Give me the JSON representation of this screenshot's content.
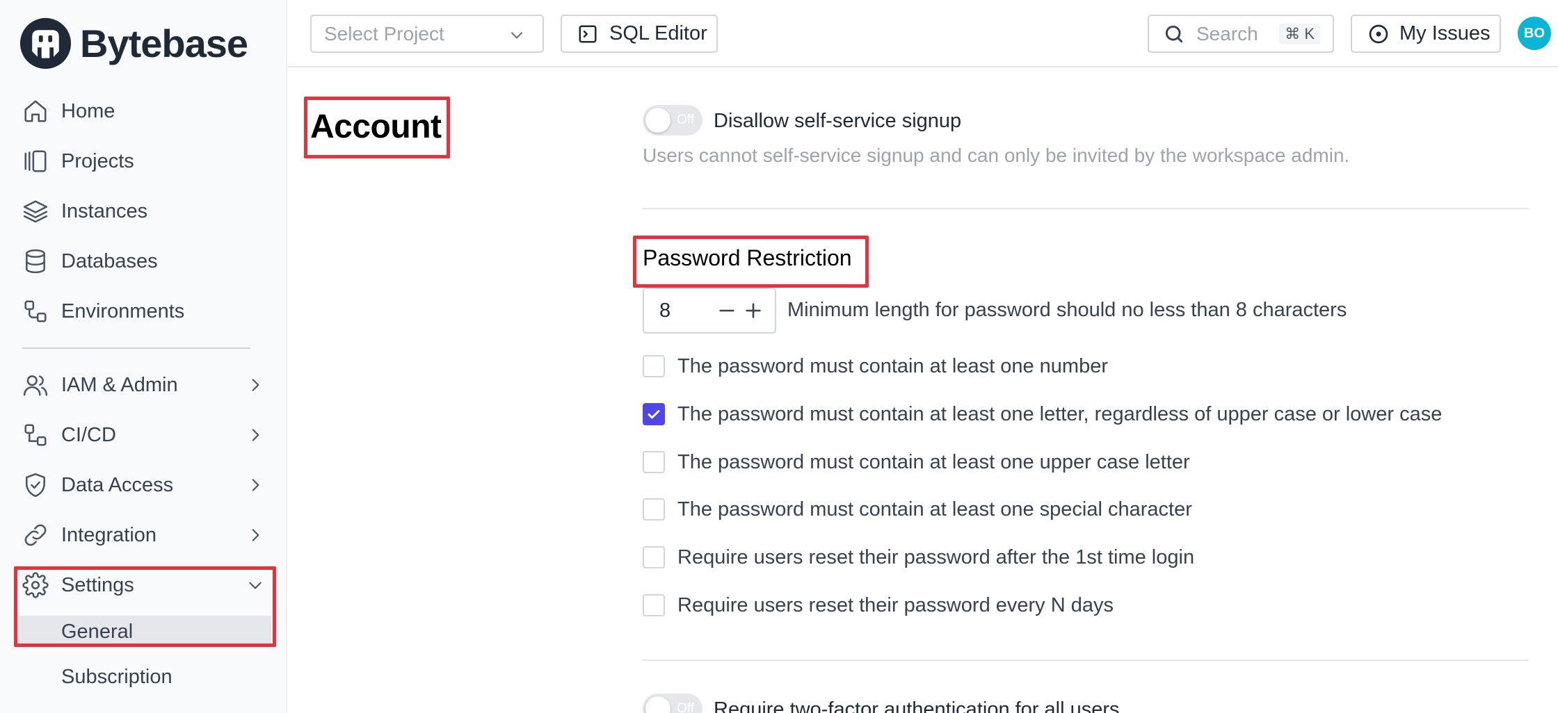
{
  "app": {
    "brand": "Bytebase"
  },
  "sidebar": {
    "items": [
      {
        "label": "Home",
        "icon": "home-icon"
      },
      {
        "label": "Projects",
        "icon": "projects-icon"
      },
      {
        "label": "Instances",
        "icon": "layers-icon"
      },
      {
        "label": "Databases",
        "icon": "database-icon"
      },
      {
        "label": "Environments",
        "icon": "environments-icon"
      },
      {
        "label": "IAM & Admin",
        "icon": "users-icon"
      },
      {
        "label": "CI/CD",
        "icon": "cicd-icon"
      },
      {
        "label": "Data Access",
        "icon": "shield-icon"
      },
      {
        "label": "Integration",
        "icon": "link-icon"
      },
      {
        "label": "Settings",
        "icon": "gear-icon"
      }
    ],
    "settings_sub": [
      {
        "label": "General",
        "active": true
      },
      {
        "label": "Subscription",
        "active": false
      }
    ]
  },
  "header": {
    "project_placeholder": "Select Project",
    "sql_editor_label": "SQL Editor",
    "search_placeholder": "Search",
    "search_shortcut": "⌘ K",
    "my_issues_label": "My Issues",
    "avatar_initials": "BO"
  },
  "main": {
    "section_title": "Account",
    "signup": {
      "toggle_state": "Off",
      "label": "Disallow self-service signup",
      "hint": "Users cannot self-service signup and can only be invited by the workspace admin."
    },
    "password": {
      "title": "Password Restriction",
      "min_length": "8",
      "min_length_desc": "Minimum length for password should no less than 8 characters",
      "rules": [
        {
          "label": "The password must contain at least one number",
          "checked": false
        },
        {
          "label": "The password must contain at least one letter, regardless of upper case or lower case",
          "checked": true
        },
        {
          "label": "The password must contain at least one upper case letter",
          "checked": false
        },
        {
          "label": "The password must contain at least one special character",
          "checked": false
        },
        {
          "label": "Require users reset their password after the 1st time login",
          "checked": false
        },
        {
          "label": "Require users reset their password every N days",
          "checked": false
        }
      ]
    },
    "two_factor": {
      "toggle_state": "Off",
      "label": "Require two-factor authentication for all users"
    }
  },
  "colors": {
    "accent": "#4f46e5",
    "highlight": "#e5323f",
    "avatar": "#0ab4d4"
  }
}
